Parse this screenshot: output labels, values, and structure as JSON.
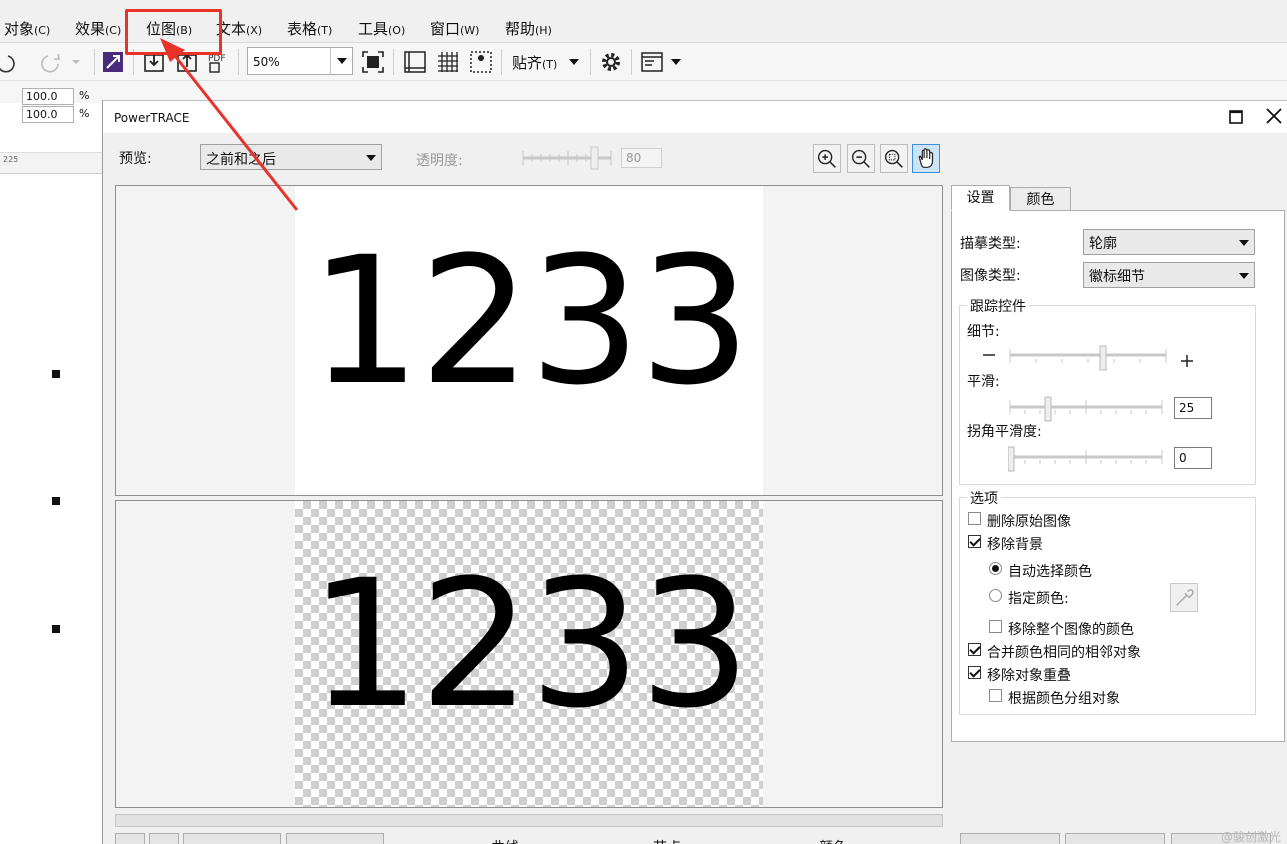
{
  "menu": {
    "items": [
      {
        "label": "对象",
        "accel": "(C)"
      },
      {
        "label": "效果",
        "accel": "(C)"
      },
      {
        "label": "位图",
        "accel": "(B)"
      },
      {
        "label": "文本",
        "accel": "(X)"
      },
      {
        "label": "表格",
        "accel": "(T)"
      },
      {
        "label": "工具",
        "accel": "(O)"
      },
      {
        "label": "窗口",
        "accel": "(W)"
      },
      {
        "label": "帮助",
        "accel": "(H)"
      }
    ]
  },
  "propbar": {
    "zoom_value": "50%",
    "snap_label": "贴齐",
    "snap_accel": "(T)"
  },
  "left": {
    "scale_x": "100.0",
    "scale_y": "100.0",
    "pct": "%",
    "ruler_tick": "225"
  },
  "dialog": {
    "title": "PowerTRACE",
    "preview_label": "预览:",
    "preview_mode": "之前和之后",
    "transparency_label": "透明度:",
    "transparency_value": "80",
    "before_text": "1233",
    "after_text": "1233",
    "bottom": {
      "curves_label": "曲线",
      "nodes_label": "节点",
      "colors_label": "颜色"
    },
    "tabs": [
      "设置",
      "颜色"
    ],
    "settings": {
      "trace_type_label": "描摹类型:",
      "trace_type_value": "轮廓",
      "image_type_label": "图像类型:",
      "image_type_value": "徽标细节",
      "trace_controls_title": "跟踪控件",
      "detail_label": "细节:",
      "smoothing_label": "平滑:",
      "smoothing_value": "25",
      "smoothing_level": 25,
      "corner_label": "拐角平滑度:",
      "corner_value": "0",
      "corner_level": 0,
      "options_title": "选项",
      "options": [
        {
          "label": "删除原始图像",
          "checked": false
        },
        {
          "label": "移除背景",
          "checked": true
        },
        {
          "label": "自动选择颜色",
          "type": "radio",
          "checked": true
        },
        {
          "label": "指定颜色:",
          "type": "radio",
          "checked": false
        },
        {
          "label": "移除整个图像的颜色",
          "checked": false
        },
        {
          "label": "合并颜色相同的相邻对象",
          "checked": true
        },
        {
          "label": "移除对象重叠",
          "checked": true
        },
        {
          "label": "根据颜色分组对象",
          "checked": false
        }
      ]
    }
  },
  "watermark": "@骏创激光",
  "colors": {
    "annotation_red": "#e8332b",
    "active_button": "#cce4f7"
  }
}
